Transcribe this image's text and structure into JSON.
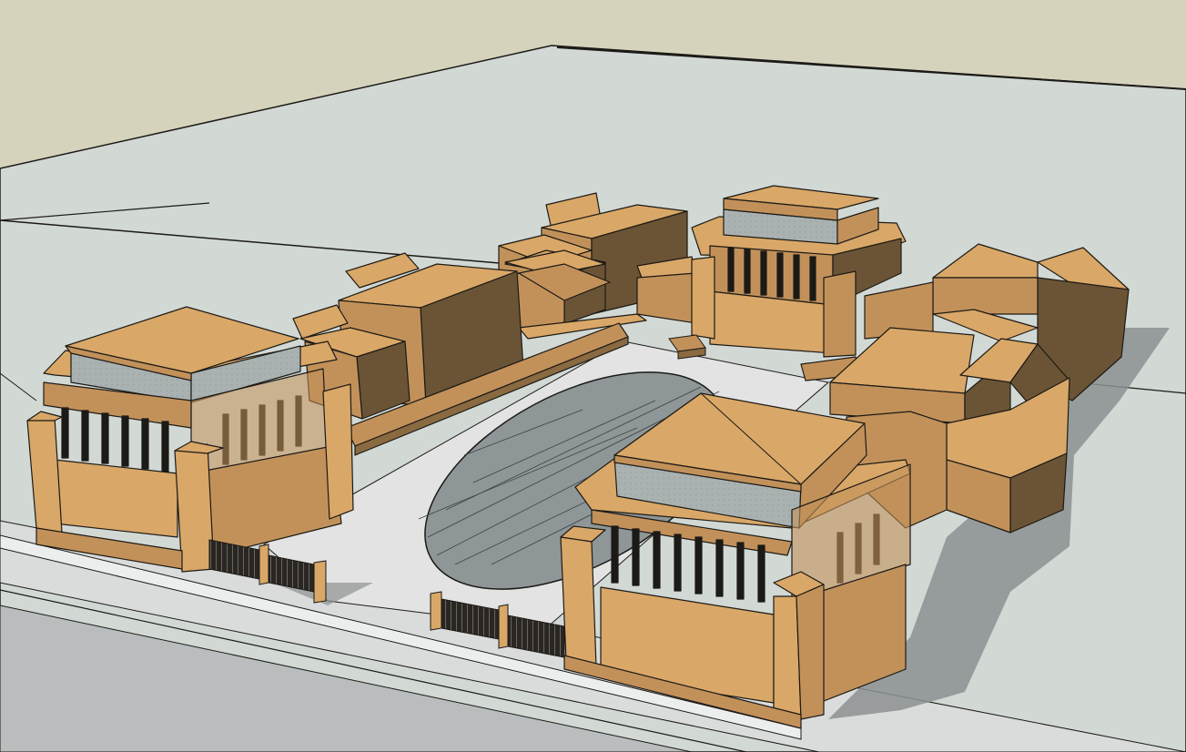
{
  "viewport": {
    "name": "3d-model-viewport",
    "description_visible_text": ""
  },
  "colors": {
    "sky": "#d6d3bd",
    "ground": "#d2d9d5",
    "plaza": "#e3e3e4",
    "road": "#c9cecd",
    "street": "#b9bdbe",
    "wall_light": "#d9a767",
    "wall_mid": "#c2915a",
    "wall_dark": "#6b5435",
    "roof": "#d9a767",
    "glass": "#a9b2b1",
    "shadow": "#8c9190",
    "line": "#1c1a16"
  }
}
